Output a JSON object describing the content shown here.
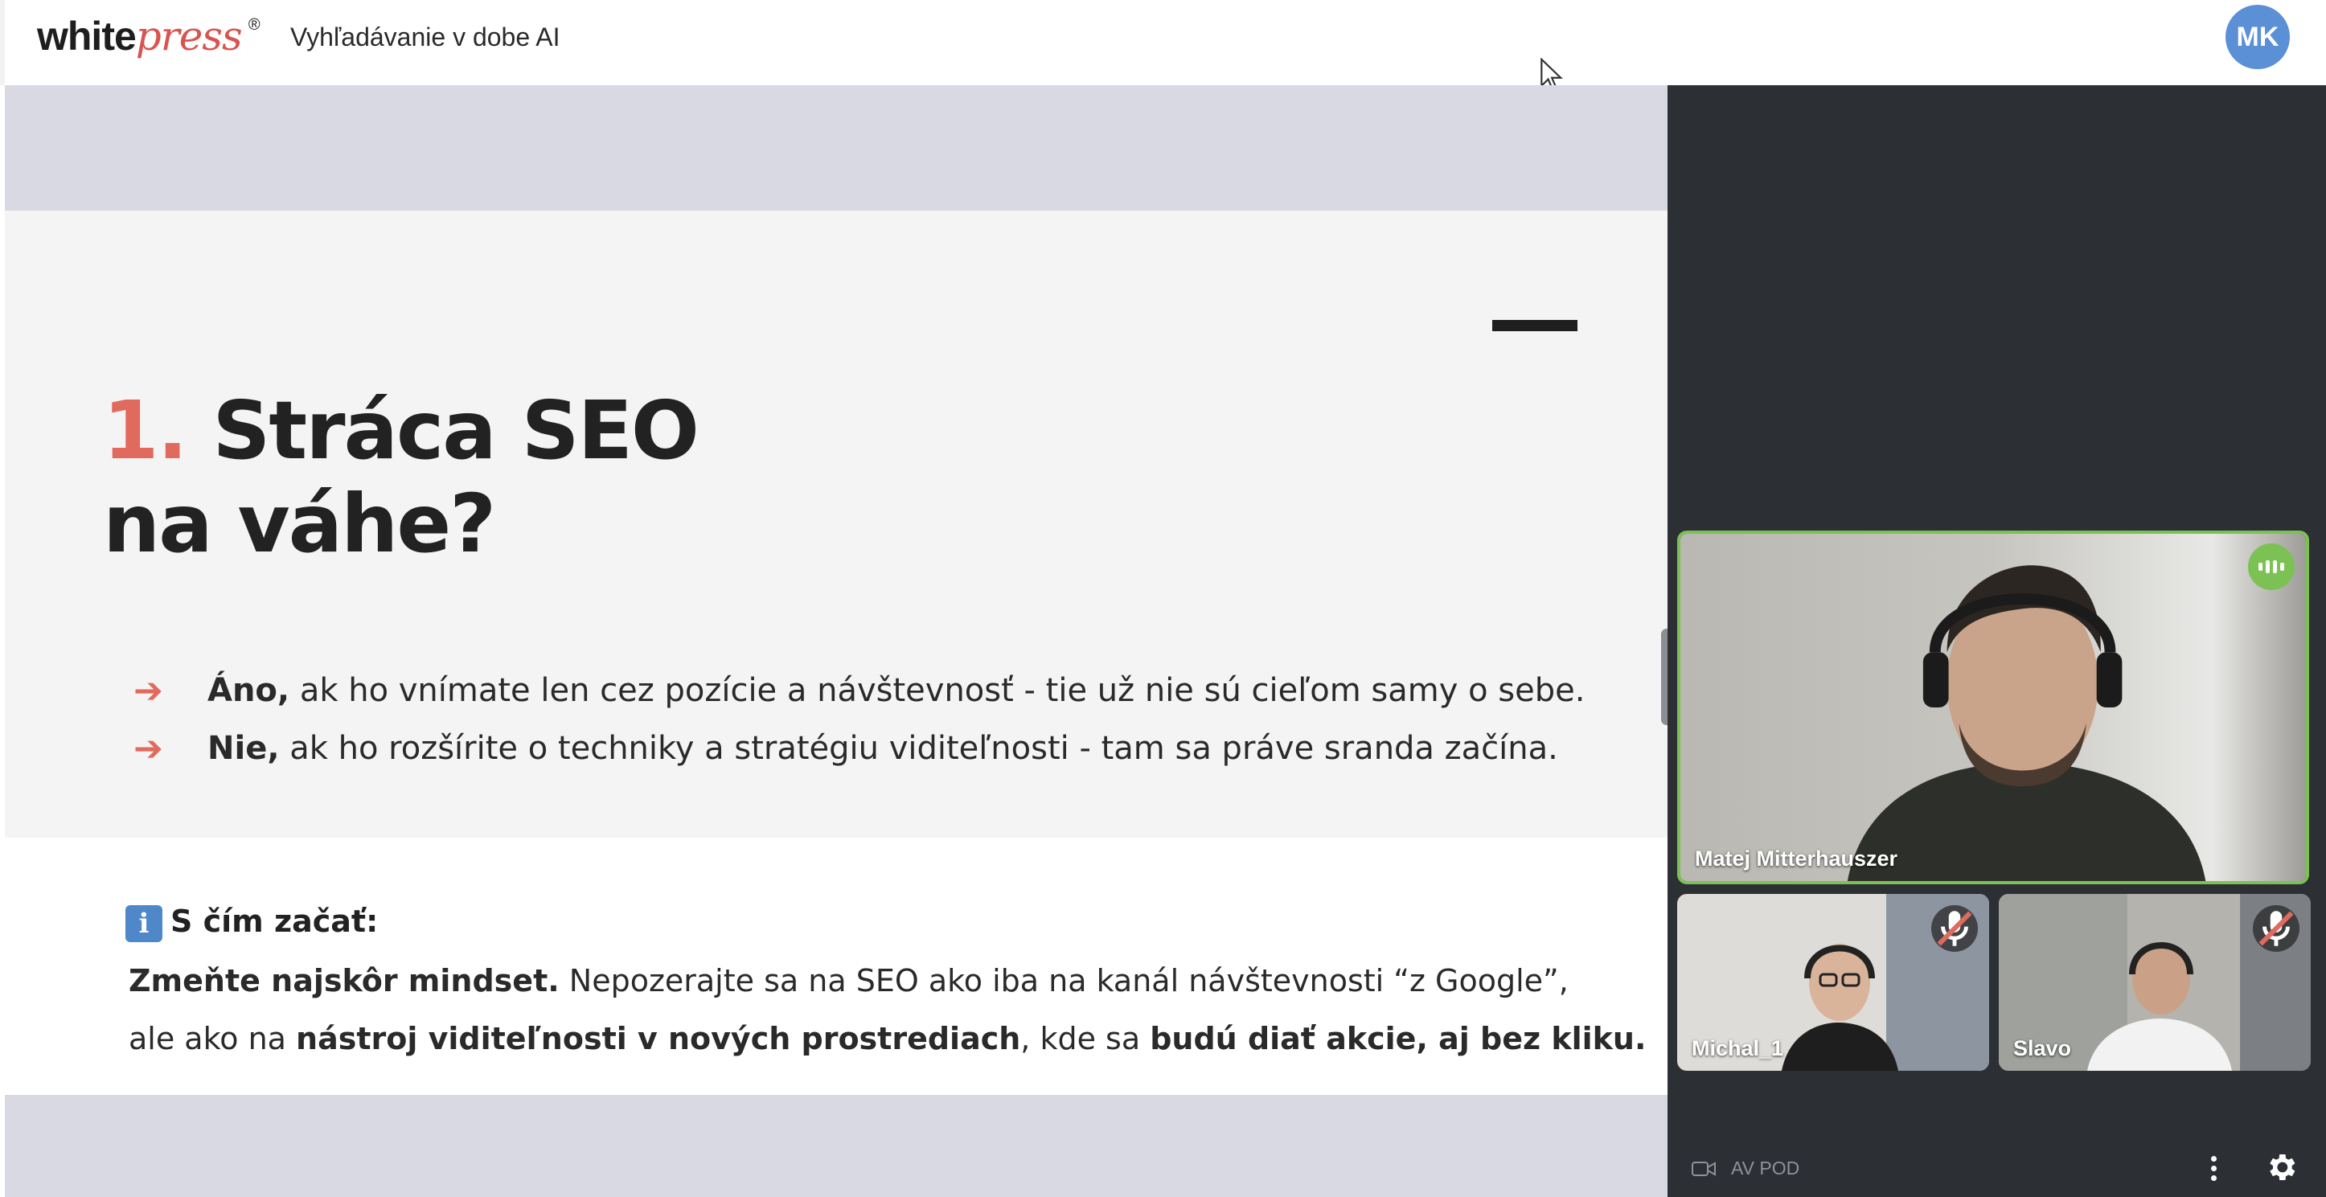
{
  "header": {
    "logo": {
      "part1": "white",
      "part2": "press",
      "registered": "®"
    },
    "meeting_title": "Vyhľadávanie v dobe AI",
    "avatar_initials": "MK"
  },
  "slide": {
    "number": "1.",
    "title_line1": "Stráca SEO",
    "title_line2": "na váhe?",
    "bullets": [
      {
        "bold": "Áno,",
        "text": " ak ho vnímate len cez pozície a návštevnosť - tie už nie sú cieľom samy o sebe."
      },
      {
        "bold": "Nie,",
        "text": " ak ho rozšírite o techniky a stratégiu viditeľnosti - tam sa práve sranda začína."
      }
    ],
    "info_icon": "i",
    "info_heading": "S čím začať:",
    "para1_bold": "Zmeňte najskôr mindset.",
    "para1_text": " Nepozerajte sa na SEO ako iba na kanál návštevnosti “z Google”,",
    "para2_text1": "ale ako na ",
    "para2_bold1": "nástroj viditeľnosti v nových prostrediach",
    "para2_text2": ", kde sa ",
    "para2_bold2": "budú diať akcie, aj bez kliku."
  },
  "participants": [
    {
      "name": "Matej Mitterhauszer",
      "status": "speaking"
    },
    {
      "name": "Michal_1",
      "status": "muted"
    },
    {
      "name": "Slavo",
      "status": "muted"
    }
  ],
  "footer": {
    "camera_label": "AV POD",
    "icons": [
      "camera-icon",
      "more-options-icon",
      "settings-gear-icon"
    ]
  },
  "colors": {
    "accent_red": "#e06a5d",
    "speaking_green": "#7cc153",
    "panel_bg": "#2c2f34",
    "avatar_blue": "#5b8fd6"
  }
}
